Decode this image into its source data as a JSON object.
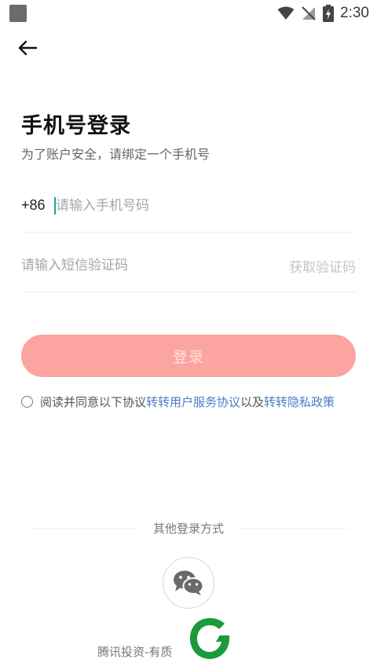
{
  "status_bar": {
    "time": "2:30",
    "icons": [
      "app-square-icon",
      "wifi-icon",
      "signal-off-icon",
      "battery-charging-icon"
    ]
  },
  "nav": {
    "back_icon": "arrow-left-icon"
  },
  "title": "手机号登录",
  "subtitle": "为了账户安全，请绑定一个手机号",
  "phone": {
    "country_code": "+86",
    "placeholder": "请输入手机号码",
    "value": ""
  },
  "sms": {
    "placeholder": "请输入短信验证码",
    "value": "",
    "get_code_label": "获取验证码"
  },
  "login_button_label": "登录",
  "agreement": {
    "prefix": "阅读并同意以下协议",
    "link1": "转转用户服务协议",
    "middle": "以及",
    "link2": "转转隐私政策",
    "checked": false
  },
  "other_login": {
    "label": "其他登录方式",
    "wechat_icon": "wechat-icon"
  },
  "footer": {
    "text": "腾讯投资-有质"
  },
  "colors": {
    "login_button_bg": "#fca49f",
    "link": "#4a7cc7",
    "caret": "#1aa39a",
    "watermark_green": "#1a9a3a"
  }
}
